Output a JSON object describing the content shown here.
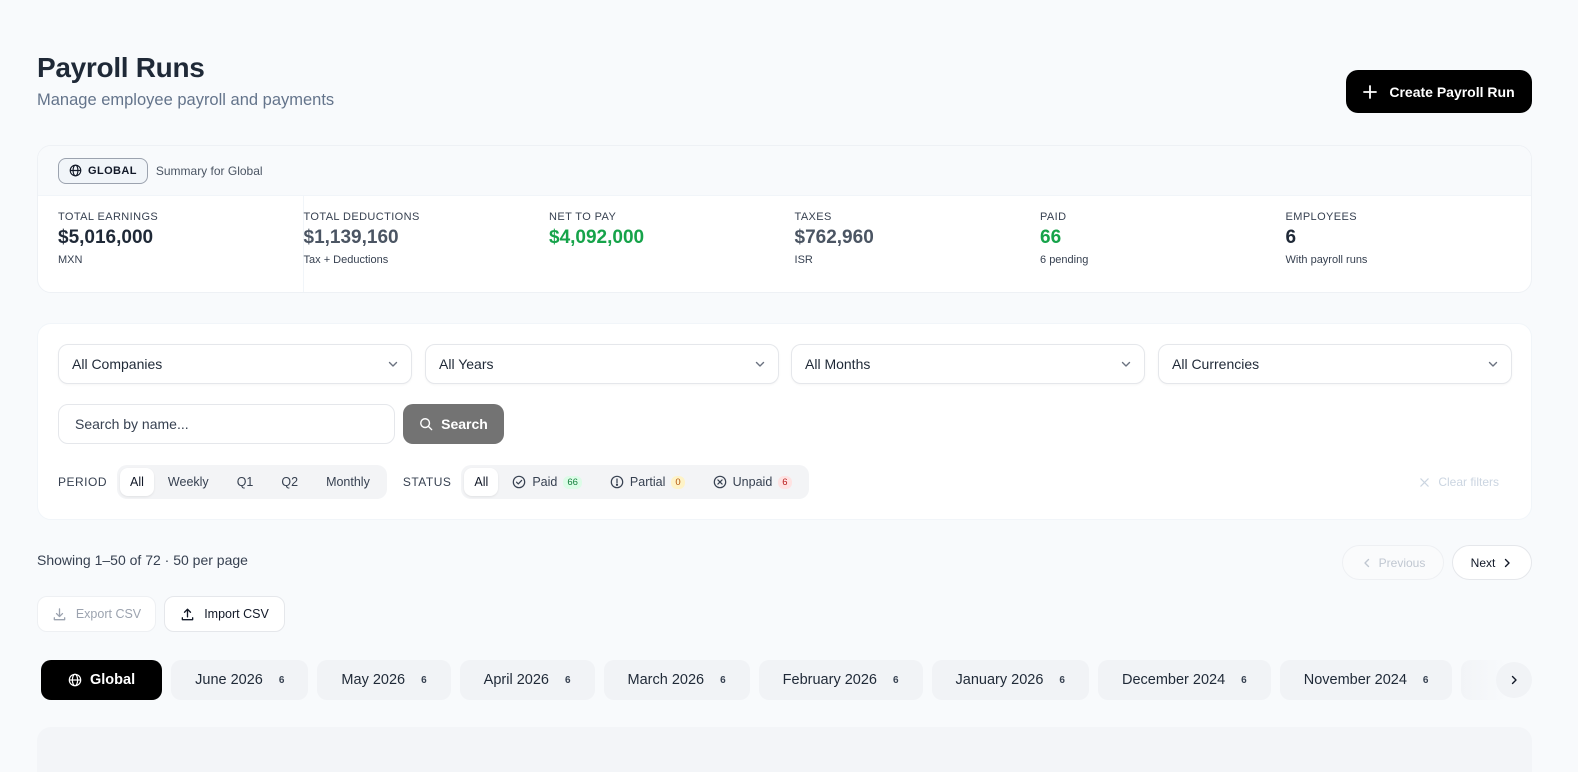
{
  "header": {
    "title": "Payroll Runs",
    "subtitle": "Manage employee payroll and payments",
    "create_label": "Create Payroll Run"
  },
  "summary": {
    "scope_label": "GLOBAL",
    "scope_desc": "Summary for Global",
    "stats": [
      {
        "label": "TOTAL EARNINGS",
        "value": "$5,016,000",
        "sub": "MXN"
      },
      {
        "label": "TOTAL DEDUCTIONS",
        "value": "$1,139,160",
        "sub": "Tax + Deductions"
      },
      {
        "label": "NET TO PAY",
        "value": "$4,092,000",
        "sub": ""
      },
      {
        "label": "TAXES",
        "value": "$762,960",
        "sub": "ISR"
      },
      {
        "label": "PAID",
        "value": "66",
        "sub": "6 pending"
      },
      {
        "label": "EMPLOYEES",
        "value": "6",
        "sub": "With payroll runs"
      }
    ]
  },
  "filters": {
    "companies": "All Companies",
    "years": "All Years",
    "months": "All Months",
    "currencies": "All Currencies",
    "search_placeholder": "Search by name...",
    "search_label": "Search",
    "period_label": "PERIOD",
    "period_options": [
      "All",
      "Weekly",
      "Q1",
      "Q2",
      "Monthly"
    ],
    "status_label": "STATUS",
    "status_all": "All",
    "status_options": [
      {
        "label": "Paid",
        "count": "66"
      },
      {
        "label": "Partial",
        "count": "0"
      },
      {
        "label": "Unpaid",
        "count": "6"
      }
    ],
    "clear_label": "Clear filters"
  },
  "pagination": {
    "showing": "Showing 1–50 of 72 · 50 per page",
    "previous": "Previous",
    "next": "Next"
  },
  "actions": {
    "export": "Export CSV",
    "import": "Import CSV"
  },
  "tabs": [
    {
      "label": "Global",
      "count": ""
    },
    {
      "label": "June 2026",
      "count": "6"
    },
    {
      "label": "May 2026",
      "count": "6"
    },
    {
      "label": "April 2026",
      "count": "6"
    },
    {
      "label": "March 2026",
      "count": "6"
    },
    {
      "label": "February 2026",
      "count": "6"
    },
    {
      "label": "January 2026",
      "count": "6"
    },
    {
      "label": "December 2024",
      "count": "6"
    },
    {
      "label": "November 2024",
      "count": "6"
    }
  ],
  "colors": {
    "primary": "#000000",
    "positive": "#16a34a",
    "background": "#f8fafc"
  }
}
